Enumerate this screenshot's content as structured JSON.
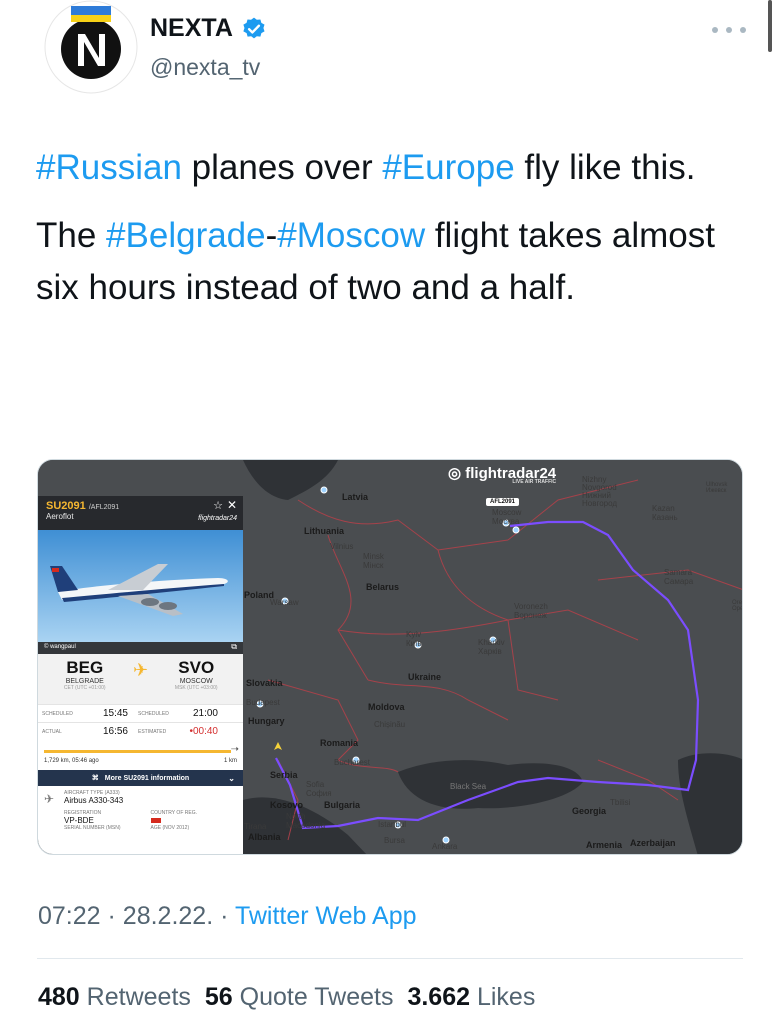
{
  "account": {
    "name": "NEXTA",
    "handle": "@nexta_tv",
    "avatar_letter": "N",
    "verified_icon": "verified-badge-icon",
    "more_icon": "more-dots-icon"
  },
  "tweet": {
    "line1": [
      {
        "text": "#Russian",
        "tag": true
      },
      {
        "text": " planes over ",
        "tag": false
      },
      {
        "text": "#Europe",
        "tag": true
      },
      {
        "text": " fly like this.",
        "tag": false
      }
    ],
    "line2": [
      {
        "text": "The ",
        "tag": false
      },
      {
        "text": "#Belgrade",
        "tag": true
      },
      {
        "text": "-",
        "tag": false
      },
      {
        "text": "#Moscow",
        "tag": true
      },
      {
        "text": " flight takes almost six hours instead of two and a half.",
        "tag": false
      }
    ]
  },
  "media": {
    "brand": "flightradar24",
    "brand_sub": "LIVE AIR TRAFFIC",
    "flight_tag": "AFL2091",
    "panel": {
      "flight": "SU2091",
      "flight_alt": "/AFL2091",
      "airline": "Aeroflot",
      "brand": "flightradar24",
      "photo_credit": "© wangpaul",
      "origin": {
        "code": "BEG",
        "city": "BELGRADE",
        "tz": "CET (UTC +01:00)"
      },
      "destination": {
        "code": "SVO",
        "city": "MOSCOW",
        "tz": "MSK (UTC +03:00)"
      },
      "rows": [
        {
          "l1": "SCHEDULED",
          "v1": "15:45",
          "l2": "SCHEDULED",
          "v2": "21:00"
        },
        {
          "l1": "ACTUAL",
          "v1": "16:56",
          "l2": "ESTIMATED",
          "v2": "•00:40"
        }
      ],
      "progress": 1.0,
      "distance": "1,729 km, 05:46 ago",
      "remaining": "1 km",
      "more_label": "More SU2091 information",
      "aircraft_type_label": "AIRCRAFT TYPE (A333)",
      "aircraft_type": "Airbus A330-343",
      "registration_label": "REGISTRATION",
      "registration": "VP-BDE",
      "country_label": "COUNTRY OF REG.",
      "serial_label": "SERIAL NUMBER (MSN)",
      "age_label": "AGE (NOV 2012)"
    },
    "labels": [
      "Latvia",
      "Lithuania",
      "Vilnius",
      "Minsk\nМінск",
      "Belarus",
      "Poland",
      "Warsaw",
      "Slovakia",
      "Budapest",
      "Hungary",
      "Moldova",
      "Chișinău",
      "Romania",
      "Bucharest",
      "Serbia",
      "Sofia\nСофия",
      "Bulgaria",
      "Kosovo",
      "North\nMacedonia",
      "Tirana",
      "Albania",
      "Istanbul",
      "Bursa",
      "Ankara",
      "Ukraine",
      "Kyiv\nКиїв",
      "Kharkiv\nХарків",
      "Voronezh\nВоронеж",
      "Moscow\nМосква",
      "Nizhny\nNovgorod\nНижний\nНовгород",
      "Kazan\nКазань",
      "Samara\nСамара",
      "Tbilisi",
      "Georgia",
      "Armenia",
      "Azerbaijan",
      "Black Sea",
      "Ulhovsk\nИжевск",
      "Ore\nОре"
    ]
  },
  "footer": {
    "time": "07:22",
    "date": "28.2.22.",
    "separator": "·",
    "app": "Twitter Web App",
    "retweets_count": "480",
    "retweets_label": "Retweets",
    "quotes_count": "56",
    "quotes_label": "Quote Tweets",
    "likes_count": "3.662",
    "likes_label": "Likes"
  },
  "colors": {
    "link": "#1d9bf0",
    "text": "#0f1419",
    "secondary": "#536471",
    "flight_path": "#7b4dff",
    "panel_accent": "#f5b731"
  }
}
